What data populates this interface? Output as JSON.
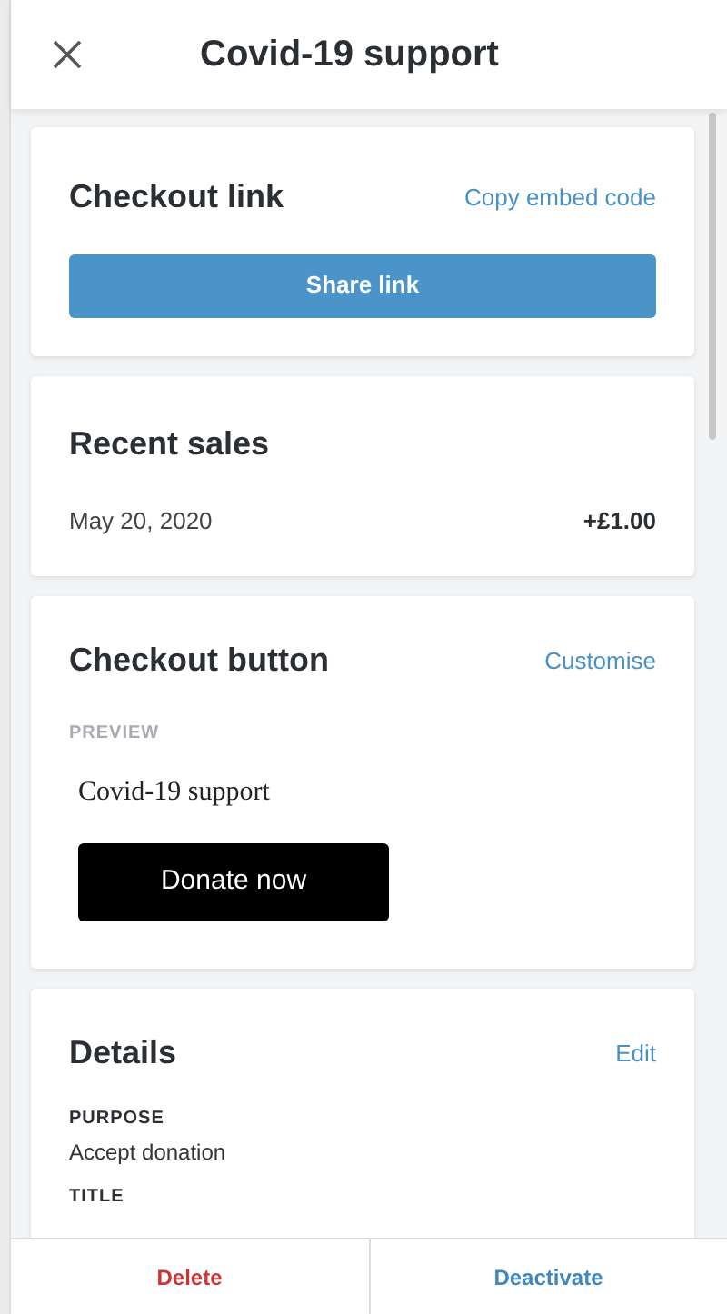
{
  "header": {
    "title": "Covid-19 support"
  },
  "checkout_link": {
    "title": "Checkout link",
    "action": "Copy embed code",
    "button": "Share link"
  },
  "recent_sales": {
    "title": "Recent sales",
    "rows": [
      {
        "date": "May 20, 2020",
        "amount": "+£1.00"
      }
    ]
  },
  "checkout_button": {
    "title": "Checkout button",
    "action": "Customise",
    "preview_label": "PREVIEW",
    "preview_title": "Covid-19 support",
    "preview_button": "Donate now"
  },
  "details": {
    "title": "Details",
    "action": "Edit",
    "fields": [
      {
        "label": "PURPOSE",
        "value": "Accept donation"
      },
      {
        "label": "TITLE"
      }
    ]
  },
  "footer": {
    "buttons": [
      {
        "label": "Delete",
        "kind": "danger"
      },
      {
        "label": "Deactivate",
        "kind": "normal"
      }
    ]
  }
}
